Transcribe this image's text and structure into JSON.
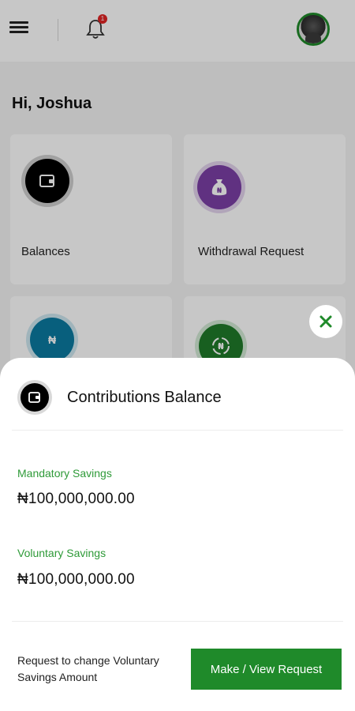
{
  "header": {
    "notification_count": "1"
  },
  "greeting": "Hi, Joshua",
  "tiles": [
    {
      "label": "Balances",
      "icon": "wallet-icon",
      "color": "#000000"
    },
    {
      "label": "Withdrawal Request",
      "icon": "naira-bag-icon",
      "color": "#7b3fa6"
    },
    {
      "label": "",
      "icon": "naira-coin-icon",
      "color": "#0b7aa0"
    },
    {
      "label": "",
      "icon": "naira-exchange-icon",
      "color": "#1f7a2a"
    }
  ],
  "sheet": {
    "title": "Contributions Balance",
    "mandatory_label": "Mandatory Savings",
    "mandatory_value": "₦100,000,000.00",
    "voluntary_label": "Voluntary Savings",
    "voluntary_value": "₦100,000,000.00",
    "note": "Request to change Voluntary Savings Amount",
    "button_label": "Make / View Request"
  },
  "colors": {
    "accent": "#1f8a2a",
    "label_green": "#2e9a38"
  }
}
